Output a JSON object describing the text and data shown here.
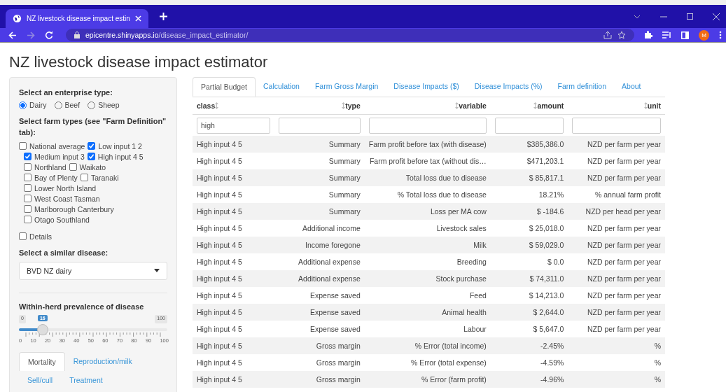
{
  "browser": {
    "tab_title": "NZ livestock disease impact estin",
    "url_host": "epicentre.shinyapps.io",
    "url_path": "/disease_impact_estimator/",
    "profile_initial": "M"
  },
  "page_title": "NZ livestock disease impact estimator",
  "sidebar": {
    "enterprise_label": "Select an enterprise type:",
    "enterprise_options": [
      {
        "label": "Dairy",
        "selected": true
      },
      {
        "label": "Beef",
        "selected": false
      },
      {
        "label": "Sheep",
        "selected": false
      }
    ],
    "farm_types_label": "Select farm types (see \"Farm Definition\" tab):",
    "farm_type_lines": [
      [
        {
          "label": "National average",
          "checked": false
        },
        {
          "label": "Low input 1 2",
          "checked": true
        }
      ],
      [
        {
          "label": "Medium input 3",
          "checked": true
        },
        {
          "label": "High input 4 5",
          "checked": true
        }
      ],
      [
        {
          "label": "Northland",
          "checked": false
        },
        {
          "label": "Waikato",
          "checked": false
        }
      ],
      [
        {
          "label": "Bay of Plenty",
          "checked": false
        },
        {
          "label": "Taranaki",
          "checked": false
        }
      ],
      [
        {
          "label": "Lower North Island",
          "checked": false
        }
      ],
      [
        {
          "label": "West Coast Tasman",
          "checked": false
        }
      ],
      [
        {
          "label": "Marlborough Canterbury",
          "checked": false
        }
      ],
      [
        {
          "label": "Otago Southland",
          "checked": false
        }
      ]
    ],
    "details": {
      "label": "Details",
      "checked": false
    },
    "disease_label": "Select a similar disease:",
    "disease_value": "BVD NZ dairy",
    "prevalence": {
      "label": "Within-herd prevalence of disease",
      "min": "0",
      "max": "100",
      "value": "16",
      "level": 0.16,
      "ticks": [
        "0",
        "10",
        "20",
        "30",
        "40",
        "50",
        "60",
        "70",
        "80",
        "90",
        "100"
      ]
    },
    "subtabs": [
      {
        "label": "Mortality",
        "selected": true
      },
      {
        "label": "Reproduction/milk",
        "selected": false
      },
      {
        "label": "Sell/cull",
        "selected": false
      },
      {
        "label": "Treatment",
        "selected": false
      }
    ]
  },
  "tabs": [
    {
      "label": "Partial Budget",
      "selected": true
    },
    {
      "label": "Calculation",
      "selected": false
    },
    {
      "label": "Farm Gross Margin",
      "selected": false
    },
    {
      "label": "Disease Impacts ($)",
      "selected": false
    },
    {
      "label": "Disease Impacts (%)",
      "selected": false
    },
    {
      "label": "Farm definition",
      "selected": false
    },
    {
      "label": "About",
      "selected": false
    }
  ],
  "table": {
    "columns": [
      "class",
      "type",
      "variable",
      "amount",
      "unit"
    ],
    "filters": [
      "high"
    ],
    "rows": [
      [
        "High input 4 5",
        "Summary",
        "Farm profit before tax (with disease)",
        "$385,386.0",
        "NZD per farm per year"
      ],
      [
        "High input 4 5",
        "Summary",
        "Farm profit before tax (without dis…",
        "$471,203.1",
        "NZD per farm per year"
      ],
      [
        "High input 4 5",
        "Summary",
        "Total loss due to disease",
        "$ 85,817.1",
        "NZD per farm per year"
      ],
      [
        "High input 4 5",
        "Summary",
        "% Total loss due to disease",
        "18.21%",
        "% annual farm profit"
      ],
      [
        "High input 4 5",
        "Summary",
        "Loss per MA cow",
        "$ -184.6",
        "NZD per head per year"
      ],
      [
        "High input 4 5",
        "Additional income",
        "Livestock sales",
        "$ 25,018.0",
        "NZD per farm per year"
      ],
      [
        "High input 4 5",
        "Income foregone",
        "Milk",
        "$ 59,029.0",
        "NZD per farm per year"
      ],
      [
        "High input 4 5",
        "Additional expense",
        "Breeding",
        "$ 0.0",
        "NZD per farm per year"
      ],
      [
        "High input 4 5",
        "Additional expense",
        "Stock purchase",
        "$ 74,311.0",
        "NZD per farm per year"
      ],
      [
        "High input 4 5",
        "Expense saved",
        "Feed",
        "$ 14,213.0",
        "NZD per farm per year"
      ],
      [
        "High input 4 5",
        "Expense saved",
        "Animal health",
        "$ 2,644.0",
        "NZD per farm per year"
      ],
      [
        "High input 4 5",
        "Expense saved",
        "Labour",
        "$ 5,647.0",
        "NZD per farm per year"
      ],
      [
        "High input 4 5",
        "Gross margin",
        "% Error (total income)",
        "-2.45%",
        "%"
      ],
      [
        "High input 4 5",
        "Gross margin",
        "% Error (total expense)",
        "-4.59%",
        "%"
      ],
      [
        "High input 4 5",
        "Gross margin",
        "% Error (farm profit)",
        "-4.96%",
        "%"
      ]
    ]
  }
}
